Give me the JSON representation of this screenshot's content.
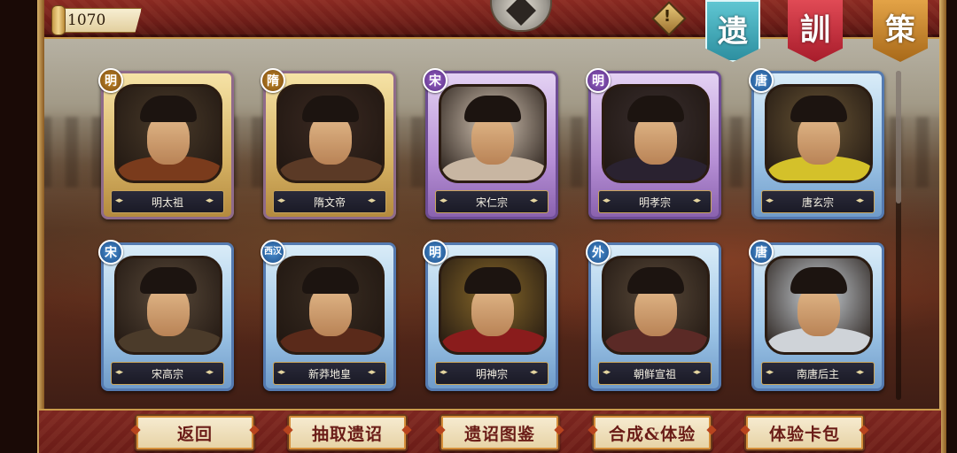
{
  "header": {
    "currency_value": "1070",
    "alert_symbol": "!",
    "tabs": [
      {
        "label": "遗",
        "color": "#3fa9b8"
      },
      {
        "label": "訓",
        "color": "#c42a3a"
      },
      {
        "label": "策",
        "color": "#c8862c"
      }
    ]
  },
  "cards": [
    {
      "dynasty": "明",
      "name": "明太祖",
      "frame": "gold"
    },
    {
      "dynasty": "隋",
      "name": "隋文帝",
      "frame": "gold"
    },
    {
      "dynasty": "宋",
      "name": "宋仁宗",
      "frame": "purple"
    },
    {
      "dynasty": "明",
      "name": "明孝宗",
      "frame": "purple"
    },
    {
      "dynasty": "唐",
      "name": "唐玄宗",
      "frame": "blue"
    },
    {
      "dynasty": "宋",
      "name": "宋高宗",
      "frame": "blue"
    },
    {
      "dynasty": "西汉",
      "name": "新莽地皇",
      "frame": "blue"
    },
    {
      "dynasty": "明",
      "name": "明神宗",
      "frame": "blue"
    },
    {
      "dynasty": "外",
      "name": "朝鲜宣祖",
      "frame": "blue"
    },
    {
      "dynasty": "唐",
      "name": "南唐后主",
      "frame": "blue"
    }
  ],
  "footer": {
    "buttons": [
      {
        "label": "返回"
      },
      {
        "label": "抽取遗诏"
      },
      {
        "label": "遗诏图鉴"
      },
      {
        "label": "合成&体验"
      },
      {
        "label": "体验卡包"
      }
    ]
  },
  "colors": {
    "frame_red": "#7c2620",
    "trim_gold": "#c99a4a",
    "button_text": "#6a1c17"
  }
}
